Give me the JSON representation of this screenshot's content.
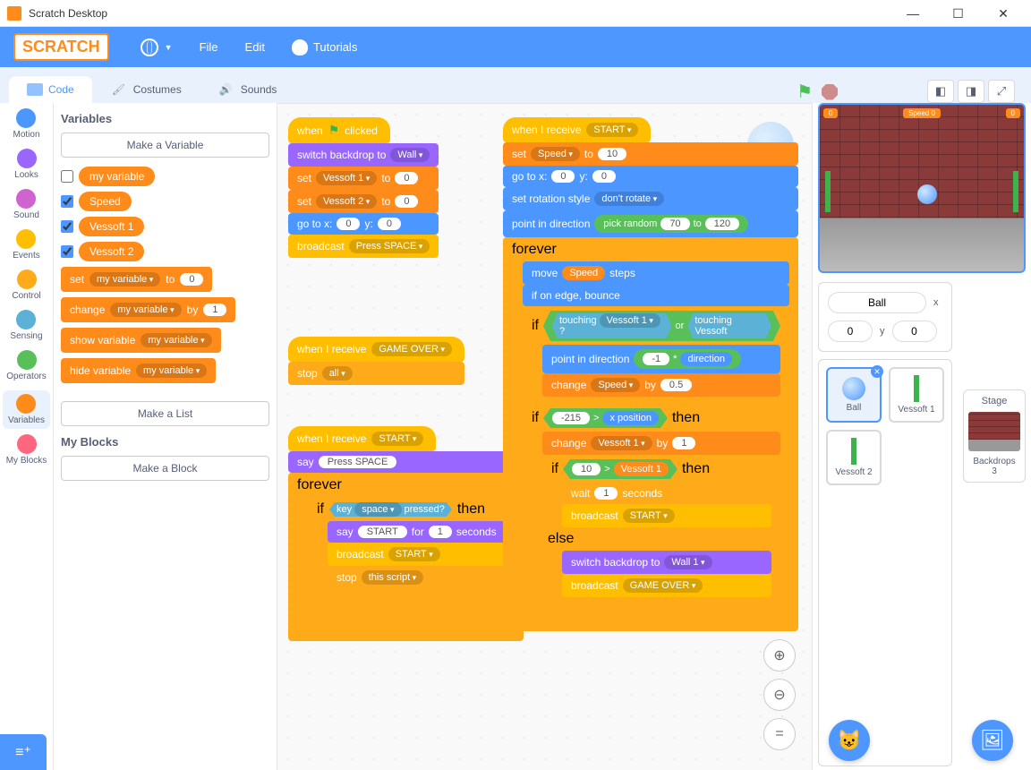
{
  "title": "Scratch Desktop",
  "menubar": {
    "logo": "SCRATCH",
    "file": "File",
    "edit": "Edit",
    "tutorials": "Tutorials"
  },
  "tabs": {
    "code": "Code",
    "costumes": "Costumes",
    "sounds": "Sounds"
  },
  "categories": [
    {
      "name": "Motion",
      "color": "#4c97ff"
    },
    {
      "name": "Looks",
      "color": "#9966ff"
    },
    {
      "name": "Sound",
      "color": "#cf63cf"
    },
    {
      "name": "Events",
      "color": "#ffbf00"
    },
    {
      "name": "Control",
      "color": "#ffab19"
    },
    {
      "name": "Sensing",
      "color": "#5cb1d6"
    },
    {
      "name": "Operators",
      "color": "#59c059"
    },
    {
      "name": "Variables",
      "color": "#ff8c1a",
      "selected": true
    },
    {
      "name": "My Blocks",
      "color": "#ff6680"
    }
  ],
  "palette": {
    "heading_vars": "Variables",
    "make_variable": "Make a Variable",
    "vars": [
      {
        "name": "my variable",
        "checked": false
      },
      {
        "name": "Speed",
        "checked": true
      },
      {
        "name": "Vessoft 1",
        "checked": true
      },
      {
        "name": "Vessoft 2",
        "checked": true
      }
    ],
    "blocks": {
      "set": "set",
      "my_variable": "my variable",
      "to": "to",
      "zero": "0",
      "change": "change",
      "by": "by",
      "one": "1",
      "show_variable": "show variable",
      "hide_variable": "hide variable"
    },
    "make_list": "Make a List",
    "heading_myblocks": "My Blocks",
    "make_block": "Make a Block"
  },
  "script1": {
    "when_clicked": "when",
    "clicked": "clicked",
    "switch_backdrop": "switch backdrop to",
    "wall": "Wall",
    "set": "set",
    "vessoft1": "Vessoft 1",
    "vessoft2": "Vessoft 2",
    "to": "to",
    "zero": "0",
    "goto": "go to x:",
    "y": "y:",
    "broadcast": "broadcast",
    "press_space": "Press SPACE"
  },
  "script2": {
    "when_receive": "when I receive",
    "game_over": "GAME OVER",
    "stop": "stop",
    "all": "all"
  },
  "script3": {
    "when_receive": "when I receive",
    "start": "START",
    "say": "say",
    "press_space": "Press SPACE",
    "forever": "forever",
    "if": "if",
    "key": "key",
    "space": "space",
    "pressed": "pressed?",
    "then": "then",
    "say2": "say",
    "start_txt": "START",
    "for": "for",
    "one": "1",
    "seconds": "seconds",
    "broadcast": "broadcast",
    "start_dd": "START",
    "stop": "stop",
    "this_script": "this script"
  },
  "script4": {
    "when_receive": "when I receive",
    "start": "START",
    "set": "set",
    "speed": "Speed",
    "to": "to",
    "ten": "10",
    "goto": "go to x:",
    "zero": "0",
    "y": "y:",
    "rot_style": "set rotation style",
    "dont_rotate": "don't rotate",
    "point_dir": "point in direction",
    "pick_random": "pick random",
    "n70": "70",
    "to2": "to",
    "n120": "120",
    "forever": "forever",
    "move": "move",
    "steps": "steps",
    "if_edge": "if on edge, bounce",
    "if": "if",
    "touching": "touching",
    "vessoft1": "Vessoft 1",
    "q": "?",
    "or": "or",
    "vessoft2": "Vessoft",
    "point_dir2": "point in direction",
    "neg1": "-1",
    "mul": "*",
    "direction": "direction",
    "change": "change",
    "speed2": "Speed",
    "by": "by",
    "half": "0.5",
    "n_215": "-215",
    "gt": ">",
    "xpos": "x position",
    "then": "then",
    "change2": "change",
    "vessoft1b": "Vessoft 1",
    "by2": "by",
    "one": "1",
    "if3": "if",
    "n10": "10",
    "gt2": ">",
    "vessoft1c": "Vessoft 1",
    "then2": "then",
    "wait": "wait",
    "one2": "1",
    "seconds": "seconds",
    "broadcast": "broadcast",
    "start2": "START",
    "else": "else",
    "switch_backdrop": "switch backdrop to",
    "wall1": "Wall 1",
    "broadcast2": "broadcast",
    "game_over": "GAME OVER"
  },
  "sprite_info": {
    "name": "Ball",
    "xlabel": "x",
    "x": "0",
    "ylabel": "y",
    "y": "0"
  },
  "sprites": [
    {
      "name": "Ball",
      "selected": true,
      "type": "ball"
    },
    {
      "name": "Vessoft 1",
      "type": "paddle"
    },
    {
      "name": "Vessoft 2",
      "type": "paddle"
    }
  ],
  "stage": {
    "label": "Stage",
    "backdrops_label": "Backdrops",
    "backdrops_count": "3"
  },
  "hud": {
    "left": "0",
    "mid": "Speed   0",
    "right": "0"
  }
}
